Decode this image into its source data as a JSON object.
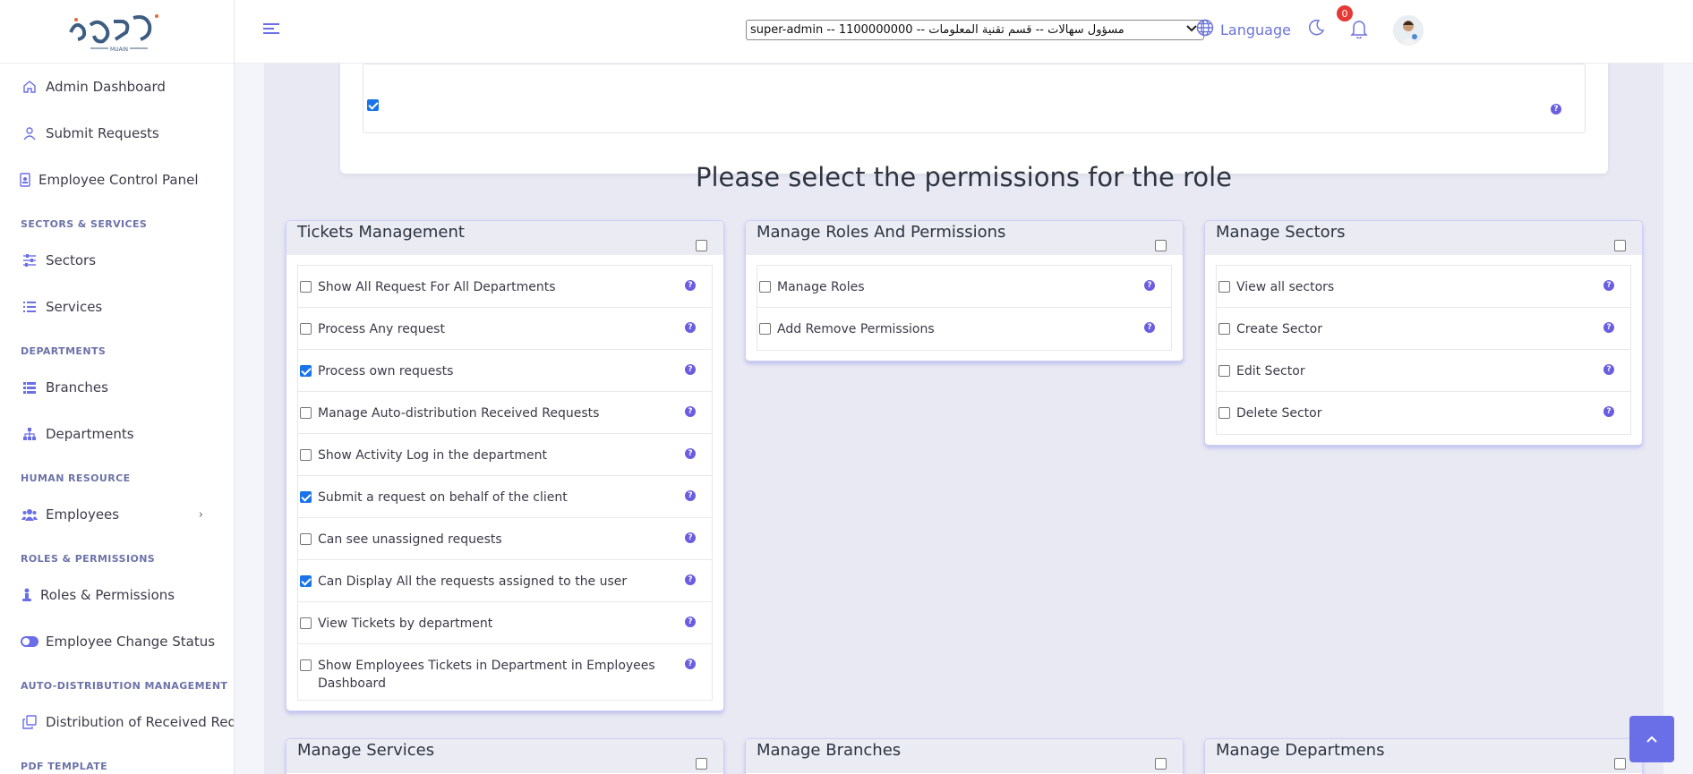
{
  "brand": {
    "logo_text": "MUAIN"
  },
  "sidebar": {
    "items": [
      {
        "label": "Admin Dashboard",
        "icon": "home-icon"
      },
      {
        "label": "Submit Requests",
        "icon": "user-icon"
      },
      {
        "label": "Employee Control Panel",
        "icon": "id-badge-icon"
      }
    ],
    "sections": [
      {
        "title": "SECTORS & SERVICES",
        "items": [
          {
            "label": "Sectors",
            "icon": "sliders-icon"
          },
          {
            "label": "Services",
            "icon": "list-icon"
          }
        ]
      },
      {
        "title": "DEPARTMENTS",
        "items": [
          {
            "label": "Branches",
            "icon": "table-list-icon"
          },
          {
            "label": "Departments",
            "icon": "sitemap-icon"
          }
        ]
      },
      {
        "title": "HUMAN RESOURCE",
        "items": [
          {
            "label": "Employees",
            "icon": "users-icon"
          }
        ]
      },
      {
        "title": "ROLES & PERMISSIONS",
        "items": [
          {
            "label": "Roles & Permissions",
            "icon": "person-icon"
          },
          {
            "label": "Employee Change Status",
            "icon": "toggle-icon"
          }
        ]
      },
      {
        "title": "AUTO-DISTRIBUTION MANAGEMENT",
        "items": [
          {
            "label": "Distribution of Received Reques",
            "icon": "copy-icon"
          }
        ]
      },
      {
        "title": "PDF TEMPLATE",
        "items": []
      }
    ]
  },
  "header": {
    "role_select": "super-admin -- 1100000000 -- مسؤول سهالات -- قسم تقنية المعلومات",
    "language_label": "Language",
    "notification_count": "0"
  },
  "main": {
    "heading": "Please select the permissions for the role",
    "cards": [
      {
        "title": "Tickets Management",
        "rows": [
          {
            "label": "Show All Request For All Departments",
            "checked": false
          },
          {
            "label": "Process Any request",
            "checked": false
          },
          {
            "label": "Process own requests",
            "checked": true
          },
          {
            "label": "Manage Auto-distribution Received Requests",
            "checked": false
          },
          {
            "label": "Show Activity Log in the department",
            "checked": false
          },
          {
            "label": "Submit a request on behalf of the client",
            "checked": true
          },
          {
            "label": "Can see unassigned requests",
            "checked": false
          },
          {
            "label": "Can Display All the requests assigned to the user",
            "checked": true
          },
          {
            "label": "View Tickets by department",
            "checked": false
          },
          {
            "label": "Show Employees Tickets in Department in Employees Dashboard",
            "checked": false
          }
        ]
      },
      {
        "title": "Manage Roles And Permissions",
        "rows": [
          {
            "label": "Manage Roles",
            "checked": false
          },
          {
            "label": "Add Remove Permissions",
            "checked": false
          }
        ]
      },
      {
        "title": "Manage Sectors",
        "rows": [
          {
            "label": "View all sectors",
            "checked": false
          },
          {
            "label": "Create Sector",
            "checked": false
          },
          {
            "label": "Edit Sector",
            "checked": false
          },
          {
            "label": "Delete Sector",
            "checked": false
          }
        ]
      },
      {
        "title": "Manage Services",
        "rows": []
      },
      {
        "title": "Manage Branches",
        "rows": []
      },
      {
        "title": "Manage Departmens",
        "rows": []
      }
    ]
  },
  "colors": {
    "accent": "#6a6fe8",
    "card_border": "#cfcff8",
    "checkbox_on": "#1a73e8",
    "badge": "#e53935"
  }
}
